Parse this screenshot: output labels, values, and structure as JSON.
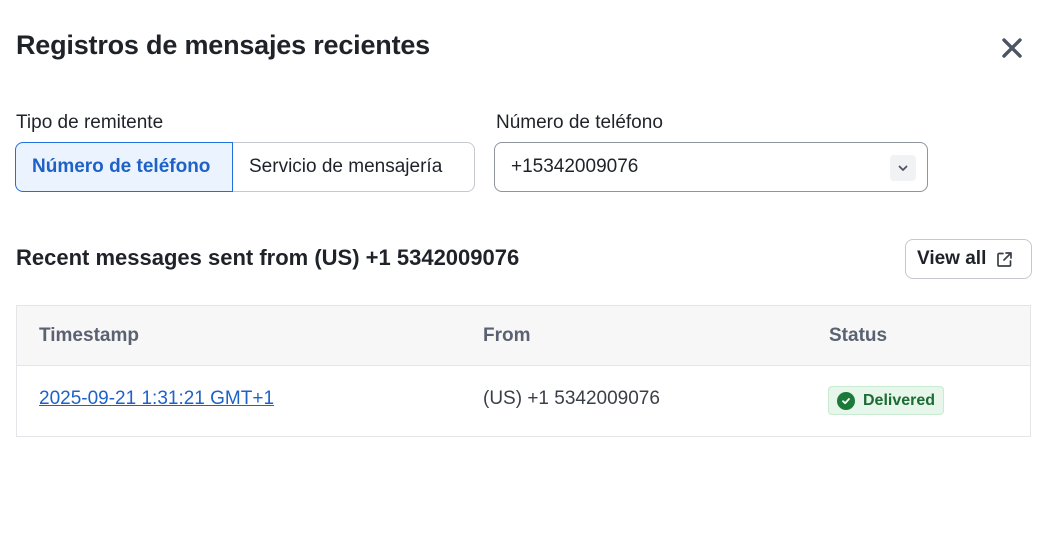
{
  "dialog": {
    "title": "Registros de mensajes recientes",
    "close_icon": "close-icon"
  },
  "filters": {
    "sender_type_label": "Tipo de remitente",
    "sender_type_options": [
      "Número de teléfono",
      "Servicio de mensajería"
    ],
    "sender_type_selected": "Número de teléfono",
    "phone_label": "Número de teléfono",
    "phone_value": "+15342009076",
    "phone_chevron_icon": "chevron-down-icon"
  },
  "recent": {
    "title": "Recent messages sent from (US) +1 5342009076",
    "view_all_label": "View all",
    "view_all_icon": "external-link-icon"
  },
  "table": {
    "columns": [
      "Timestamp",
      "From",
      "Status"
    ],
    "rows": [
      {
        "timestamp": "2025-09-21 1:31:21 GMT+1",
        "from": "(US) +1 5342009076",
        "status": "Delivered",
        "status_icon": "check-circle-icon"
      }
    ]
  },
  "colors": {
    "accent": "#1e62c8",
    "status_success": "#1b7a3a"
  }
}
